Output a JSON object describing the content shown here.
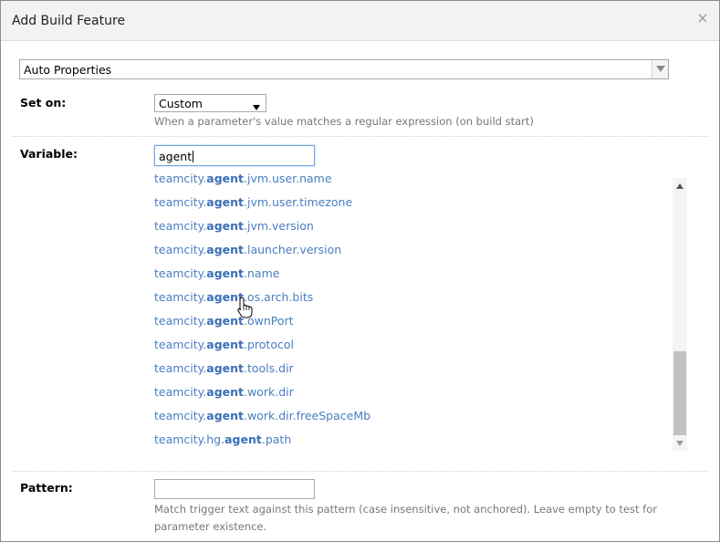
{
  "dialog": {
    "title": "Add Build Feature",
    "close_icon": "close-icon"
  },
  "feature_select": {
    "value": "Auto Properties"
  },
  "set_on": {
    "label": "Set on:",
    "value": "Custom",
    "hint": "When a parameter's value matches a regular expression (on build start)"
  },
  "variable": {
    "label": "Variable:",
    "value": "agent",
    "suggestions": [
      {
        "prefix": "teamcity.",
        "match": "agent",
        "suffix": ".jvm.user.name"
      },
      {
        "prefix": "teamcity.",
        "match": "agent",
        "suffix": ".jvm.user.timezone"
      },
      {
        "prefix": "teamcity.",
        "match": "agent",
        "suffix": ".jvm.version"
      },
      {
        "prefix": "teamcity.",
        "match": "agent",
        "suffix": ".launcher.version"
      },
      {
        "prefix": "teamcity.",
        "match": "agent",
        "suffix": ".name"
      },
      {
        "prefix": "teamcity.",
        "match": "agent",
        "suffix": ".os.arch.bits"
      },
      {
        "prefix": "teamcity.",
        "match": "agent",
        "suffix": ".ownPort"
      },
      {
        "prefix": "teamcity.",
        "match": "agent",
        "suffix": ".protocol"
      },
      {
        "prefix": "teamcity.",
        "match": "agent",
        "suffix": ".tools.dir"
      },
      {
        "prefix": "teamcity.",
        "match": "agent",
        "suffix": ".work.dir"
      },
      {
        "prefix": "teamcity.",
        "match": "agent",
        "suffix": ".work.dir.freeSpaceMb"
      },
      {
        "prefix": "teamcity.hg.",
        "match": "agent",
        "suffix": ".path"
      }
    ]
  },
  "pattern": {
    "label": "Pattern:",
    "value": "",
    "hint": "Match trigger text against this pattern (case insensitive, not anchored). Leave empty to test for parameter existence."
  },
  "colors": {
    "link": "#4a7ec2",
    "hint": "#777777",
    "focus_border": "#74a6e0"
  }
}
